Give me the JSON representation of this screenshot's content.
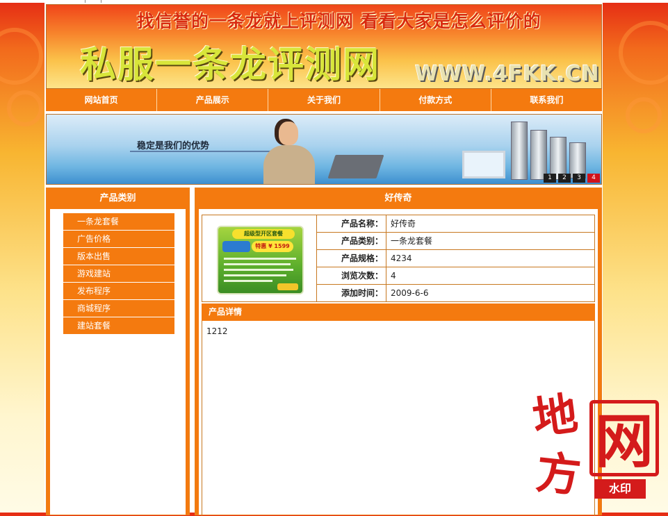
{
  "banner": {
    "slogan": "找信誉的一条龙就上评测网  看看大家是怎么评价的",
    "site_name": "私服一条龙评测网",
    "url": "WWW.4FKK.CN"
  },
  "nav": {
    "items": [
      "网站首页",
      "产品展示",
      "关于我们",
      "付款方式",
      "联系我们"
    ]
  },
  "hero": {
    "tagline": "稳定是我们的优势",
    "pages": [
      "1",
      "2",
      "3",
      "4"
    ],
    "active_page": "4"
  },
  "sidebar": {
    "title": "产品类别",
    "items": [
      "一条龙套餐",
      "广告价格",
      "版本出售",
      "游戏建站",
      "发布程序",
      "商城程序",
      "建站套餐"
    ]
  },
  "product": {
    "title": "好传奇",
    "specs": [
      {
        "label": "产品名称：",
        "value": "好传奇"
      },
      {
        "label": "产品类别：",
        "value": "一条龙套餐"
      },
      {
        "label": "产品规格：",
        "value": "4234"
      },
      {
        "label": "浏览次数：",
        "value": "4"
      },
      {
        "label": "添加时间：",
        "value": "2009-6-6"
      }
    ],
    "detail_title": "产品详情",
    "detail_text": "1212",
    "thumb_banner": "超级型开区套餐",
    "thumb_price": "特惠 ¥ 1599"
  },
  "watermark": {
    "char1": "地",
    "char2": "方",
    "char3": "网",
    "label": "水印"
  },
  "colors": {
    "accent": "#f47a0f",
    "border": "#c7771f",
    "watermark": "#d41b1b"
  }
}
